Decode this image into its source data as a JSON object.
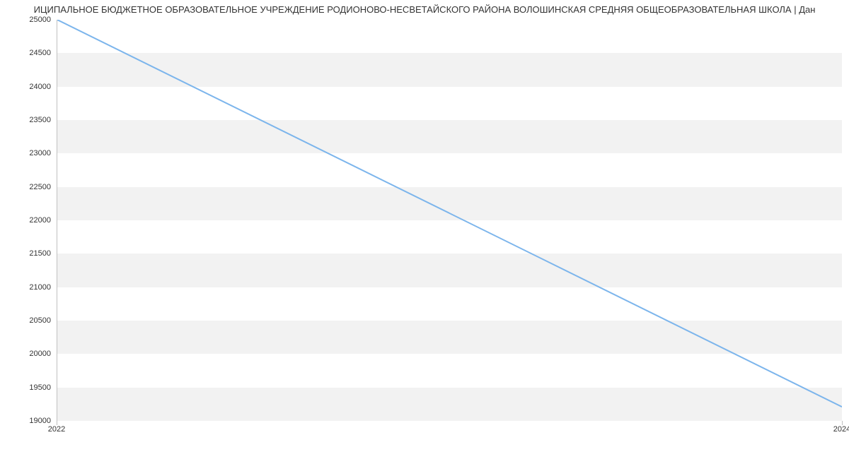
{
  "chart_data": {
    "type": "line",
    "title": "ИЦИПАЛЬНОЕ БЮДЖЕТНОЕ ОБРАЗОВАТЕЛЬНОЕ УЧРЕЖДЕНИЕ РОДИОНОВО-НЕСВЕТАЙСКОГО РАЙОНА ВОЛОШИНСКАЯ СРЕДНЯЯ ОБЩЕОБРАЗОВАТЕЛЬНАЯ ШКОЛА | Дан",
    "x": [
      2022,
      2024
    ],
    "values": [
      25000,
      19200
    ],
    "xlabel": "",
    "ylabel": "",
    "xlim": [
      2022,
      2024
    ],
    "ylim": [
      19000,
      25000
    ],
    "y_ticks": [
      19000,
      19500,
      20000,
      20500,
      21000,
      21500,
      22000,
      22500,
      23000,
      23500,
      24000,
      24500,
      25000
    ],
    "x_ticks": [
      2022,
      2024
    ],
    "line_color": "#7cb5ec",
    "band_color": "#f2f2f2"
  }
}
